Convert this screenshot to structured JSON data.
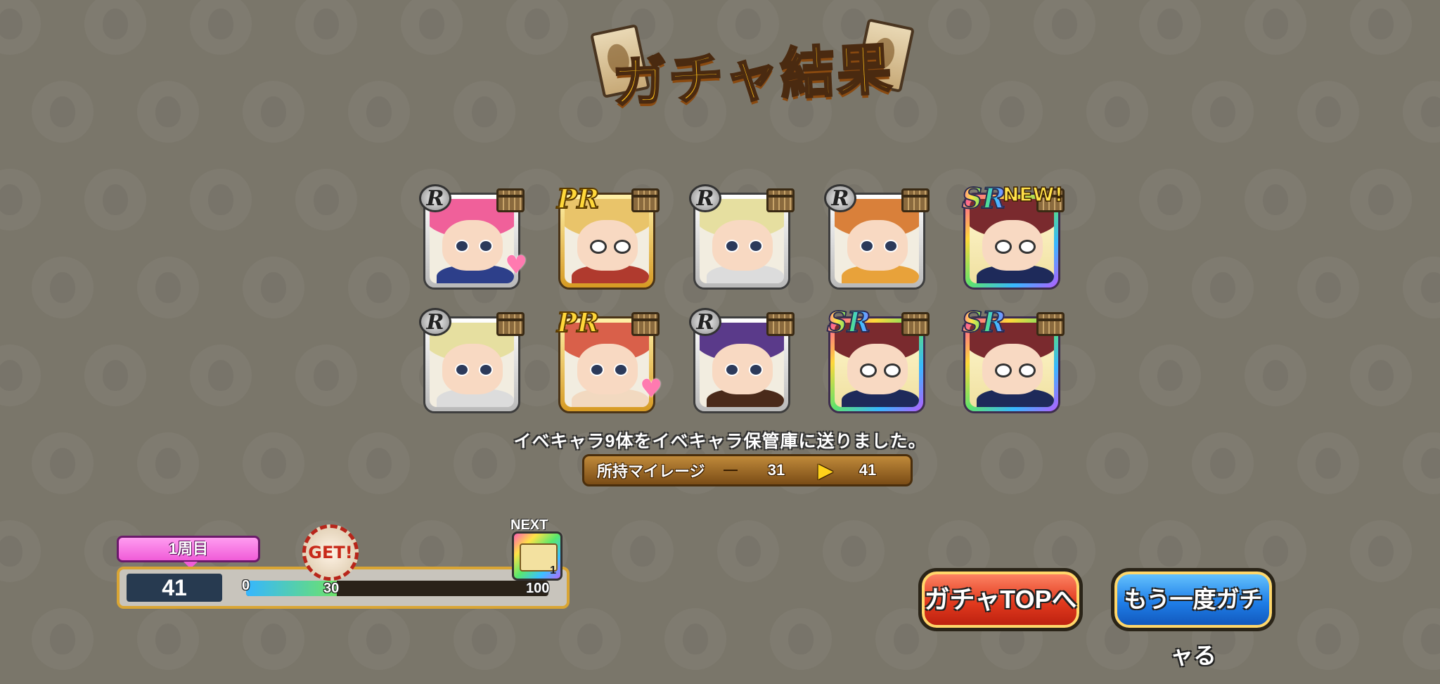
{
  "title": "ガチャ結果",
  "cards": [
    {
      "rarity": "R",
      "frame": "r",
      "hair": "#f0609a",
      "body": "#2d3f8a",
      "glasses": false,
      "new": false,
      "heart": true
    },
    {
      "rarity": "PR",
      "frame": "pr",
      "hair": "#e9c46a",
      "body": "#b03a2e",
      "glasses": true,
      "new": false,
      "heart": false
    },
    {
      "rarity": "R",
      "frame": "r",
      "hair": "#e6dfa0",
      "body": "#dcdcdc",
      "glasses": false,
      "new": false,
      "heart": false
    },
    {
      "rarity": "R",
      "frame": "r",
      "hair": "#d9803a",
      "body": "#e8a23a",
      "glasses": false,
      "new": false,
      "heart": false
    },
    {
      "rarity": "SR",
      "frame": "sr",
      "hair": "#7a2a2e",
      "body": "#1e2a5a",
      "glasses": true,
      "new": true,
      "heart": false
    },
    {
      "rarity": "R",
      "frame": "r",
      "hair": "#e6dfa0",
      "body": "#dcdcdc",
      "glasses": false,
      "new": false,
      "heart": false
    },
    {
      "rarity": "PR",
      "frame": "pr",
      "hair": "#d9604a",
      "body": "#f2d9c0",
      "glasses": false,
      "new": false,
      "heart": true
    },
    {
      "rarity": "R",
      "frame": "r",
      "hair": "#5a3a8a",
      "body": "#4a2a1a",
      "glasses": false,
      "new": false,
      "heart": false
    },
    {
      "rarity": "SR",
      "frame": "sr",
      "hair": "#7a2a2e",
      "body": "#1e2a5a",
      "glasses": true,
      "new": false,
      "heart": false
    },
    {
      "rarity": "SR",
      "frame": "sr",
      "hair": "#7a2a2e",
      "body": "#1e2a5a",
      "glasses": true,
      "new": false,
      "heart": false
    }
  ],
  "new_label": "NEW!",
  "notice": "イベキャラ9体をイベキャラ保管庫に送りました。",
  "mileage": {
    "label": "所持マイレージ",
    "before": "31",
    "arrow": "▶",
    "after": "41"
  },
  "progress": {
    "loop_label": "1周目",
    "count": "41",
    "tick_min": "0",
    "tick_mid": "30",
    "tick_max": "100",
    "fill_fraction": 0.3,
    "get_label": "GET!",
    "next_label": "NEXT",
    "next_reward_label": "SR",
    "next_reward_count": "1"
  },
  "buttons": {
    "gacha_top": "ガチャTOPへ",
    "gacha_again": "もう一度ガチャる"
  }
}
